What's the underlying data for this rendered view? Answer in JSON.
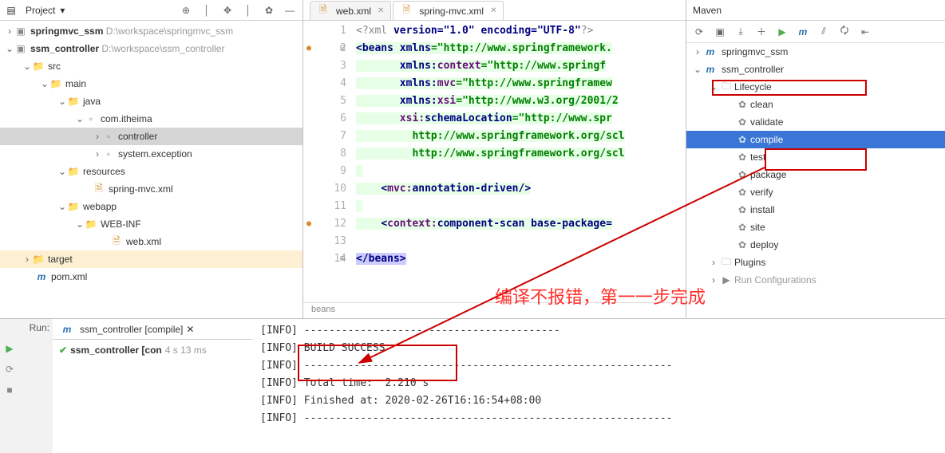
{
  "project": {
    "title": "Project",
    "tree": {
      "root1": {
        "name": "springmvc_ssm",
        "path": "D:\\workspace\\springmvc_ssm"
      },
      "root2": {
        "name": "ssm_controller",
        "path": "D:\\workspace\\ssm_controller"
      },
      "src": "src",
      "main": "main",
      "java": "java",
      "pkg": "com.itheima",
      "controller": "controller",
      "sysexc": "system.exception",
      "resources": "resources",
      "springmvc_xml": "spring-mvc.xml",
      "webapp": "webapp",
      "webinf": "WEB-INF",
      "webxml": "web.xml",
      "target": "target",
      "pom": "pom.xml"
    }
  },
  "editor": {
    "tabs": [
      {
        "label": "web.xml",
        "active": false
      },
      {
        "label": "spring-mvc.xml",
        "active": true
      }
    ],
    "gutter": [
      "1",
      "2",
      "3",
      "4",
      "5",
      "6",
      "7",
      "8",
      "9",
      "10",
      "11",
      "12",
      "13",
      "14"
    ],
    "lines": {
      "l1_a": "<?xml",
      "l1_attr": " version=\"1.0\" encoding=\"UTF-8\"",
      "l1_b": "?>",
      "l2_tag": "<beans",
      "l2_attr": " xmlns",
      "l2_val": "=\"http://www.springframework.",
      "l3_attr": "xmlns:",
      "l3_ns": "context",
      "l3_val": "=\"http://www.springf",
      "l4_attr": "xmlns:",
      "l4_ns": "mvc",
      "l4_val": "=\"http://www.springframew",
      "l5_attr": "xmlns:",
      "l5_ns": "xsi",
      "l5_val": "=\"http://www.w3.org/2001/2",
      "l6_attr": "xsi:",
      "l6_ns": "schemaLocation",
      "l6_val": "=\"http://www.spr",
      "l7": "http://www.springframework.org/scl",
      "l8": "http://www.springframework.org/scl",
      "l10_open": "<",
      "l10_ns": "mvc:",
      "l10_tag": "annotation-driven",
      "l10_close": "/>",
      "l12_open": "<",
      "l12_ns": "context:",
      "l12_tag": "component-scan",
      "l12_attr": " base-package=",
      "l14": "</beans>"
    },
    "foot": "beans"
  },
  "maven": {
    "title": "Maven",
    "tree": {
      "p1": "springmvc_ssm",
      "p2": "ssm_controller",
      "lifecycle": "Lifecycle",
      "goals": [
        "clean",
        "validate",
        "compile",
        "test",
        "package",
        "verify",
        "install",
        "site",
        "deploy"
      ],
      "plugins": "Plugins",
      "runconf": "Run Configurations"
    }
  },
  "run": {
    "label": "Run:",
    "tab": "ssm_controller [compile]",
    "result": "ssm_controller [con",
    "result_time": "4 s 13 ms",
    "console": "[INFO] -----------------------------------------\n[INFO] BUILD SUCCESS\n[INFO] -----------------------------------------------------------\n[INFO] Total time:  2.210 s\n[INFO] Finished at: 2020-02-26T16:16:54+08:00\n[INFO] -----------------------------------------------------------"
  },
  "annotation": "编译不报错，第一一步完成"
}
